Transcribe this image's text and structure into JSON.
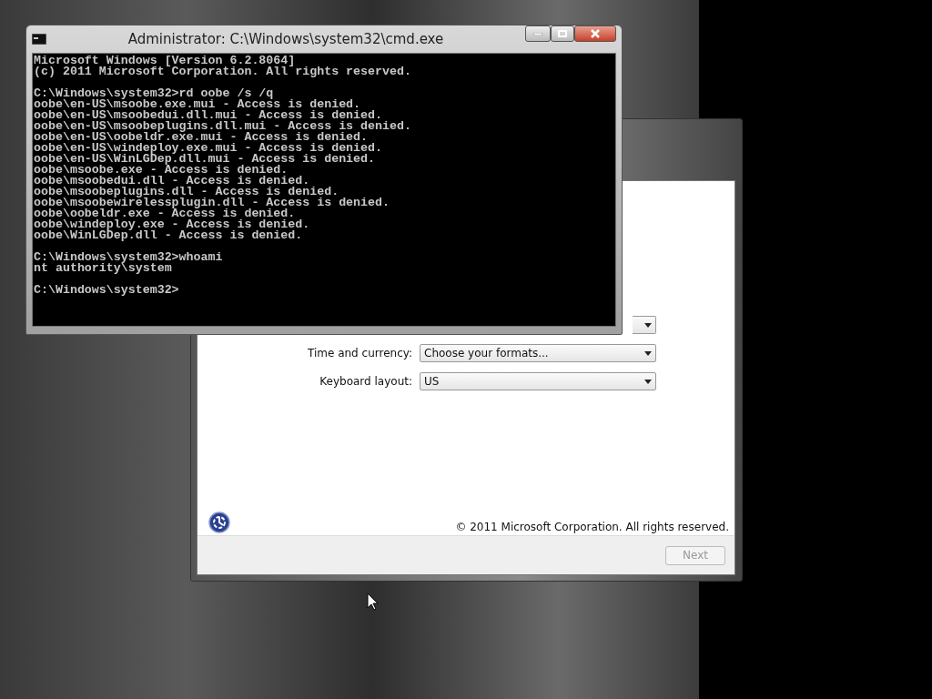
{
  "console_window": {
    "title": "Administrator: C:\\Windows\\system32\\cmd.exe",
    "blocks": [
      [
        "Microsoft Windows [Version 6.2.8064]",
        "(c) 2011 Microsoft Corporation. All rights reserved."
      ],
      [
        "C:\\Windows\\system32>rd oobe /s /q",
        "oobe\\en-US\\msoobe.exe.mui - Access is denied.",
        "oobe\\en-US\\msoobedui.dll.mui - Access is denied.",
        "oobe\\en-US\\msoobeplugins.dll.mui - Access is denied.",
        "oobe\\en-US\\oobeldr.exe.mui - Access is denied.",
        "oobe\\en-US\\windeploy.exe.mui - Access is denied.",
        "oobe\\en-US\\WinLGDep.dll.mui - Access is denied.",
        "oobe\\msoobe.exe - Access is denied.",
        "oobe\\msoobedui.dll - Access is denied.",
        "oobe\\msoobeplugins.dll - Access is denied.",
        "oobe\\msoobewirelessplugin.dll - Access is denied.",
        "oobe\\oobeldr.exe - Access is denied.",
        "oobe\\windeploy.exe - Access is denied.",
        "oobe\\WinLGDep.dll - Access is denied."
      ],
      [
        "C:\\Windows\\system32>whoami",
        "nt authority\\system"
      ],
      [
        "C:\\Windows\\system32>"
      ]
    ]
  },
  "setup_window": {
    "fields": [
      {
        "label": "Time and currency:",
        "value": "Choose your formats..."
      },
      {
        "label": "Keyboard layout:",
        "value": "US"
      }
    ],
    "copyright": "© 2011 Microsoft Corporation. All rights reserved.",
    "next_button": {
      "label": "Next",
      "disabled": true
    }
  }
}
